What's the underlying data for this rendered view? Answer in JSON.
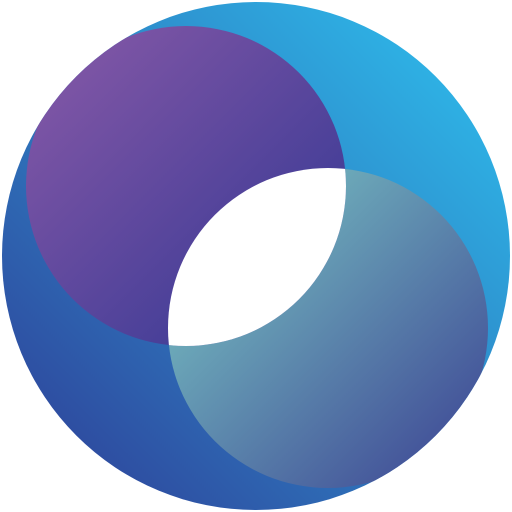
{
  "logo": {
    "icon_name": "overlapping-circles-logo",
    "colors": {
      "outer_light_blue": "#2ec4f1",
      "outer_dark_blue": "#2e3a94",
      "top_left_purple": "#8a5aa8",
      "top_left_indigo": "#2e3592",
      "bottom_right_teal": "#7fd1c7",
      "bottom_right_navy": "#3a3f92",
      "center_cutout": "#ffffff"
    }
  }
}
